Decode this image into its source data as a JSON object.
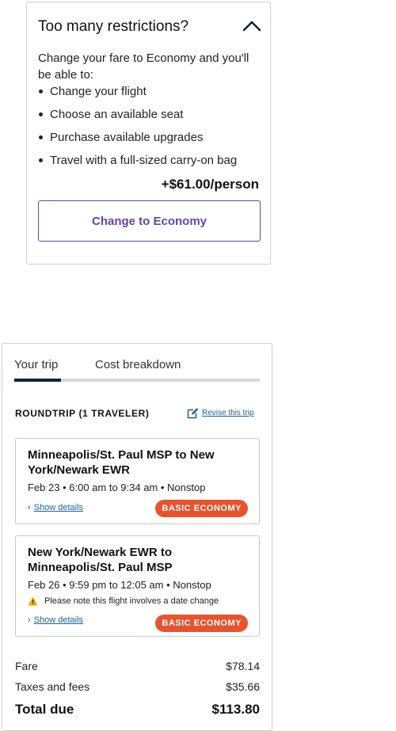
{
  "restrictions": {
    "title": "Too many restrictions?",
    "description": "Change your fare to Economy and you'll be able to:",
    "benefits": [
      "Change your flight",
      "Choose an available seat",
      "Purchase available upgrades",
      "Travel with a full-sized carry-on bag"
    ],
    "price": "+$61.00/person",
    "button_label": "Change to Economy",
    "accent_color": "#6244bb"
  },
  "trip": {
    "tabs": [
      "Your trip",
      "Cost breakdown"
    ],
    "active_tab": "Your trip",
    "heading": "ROUNDTRIP (1 TRAVELER)",
    "revise_label": "Revise this trip",
    "segments": [
      {
        "route": "Minneapolis/St. Paul MSP to New York/Newark EWR",
        "times": "Feb 23 • 6:00 am to 9:34 am • Nonstop",
        "details_label": "Show details",
        "badge": "BASIC ECONOMY"
      },
      {
        "route": "New York/Newark EWR to Minneapolis/St. Paul MSP",
        "times": "Feb 26 • 9:59 pm to 12:05 am • Nonstop",
        "warning": "Please note this flight involves a date change",
        "details_label": "Show details",
        "badge": "BASIC ECONOMY"
      }
    ],
    "costs": {
      "fare_label": "Fare",
      "fare_value": "$78.14",
      "taxes_label": "Taxes and fees",
      "taxes_value": "$35.66",
      "total_label": "Total due",
      "total_value": "$113.80"
    },
    "badge_color": "#e8532e",
    "tab_active_color": "#0c2340",
    "link_color": "#1a5fa0"
  },
  "icons": {
    "collapse": "chevron-up-icon",
    "revise": "edit-icon",
    "warning": "warning-icon",
    "details": "chevron-right-icon"
  }
}
